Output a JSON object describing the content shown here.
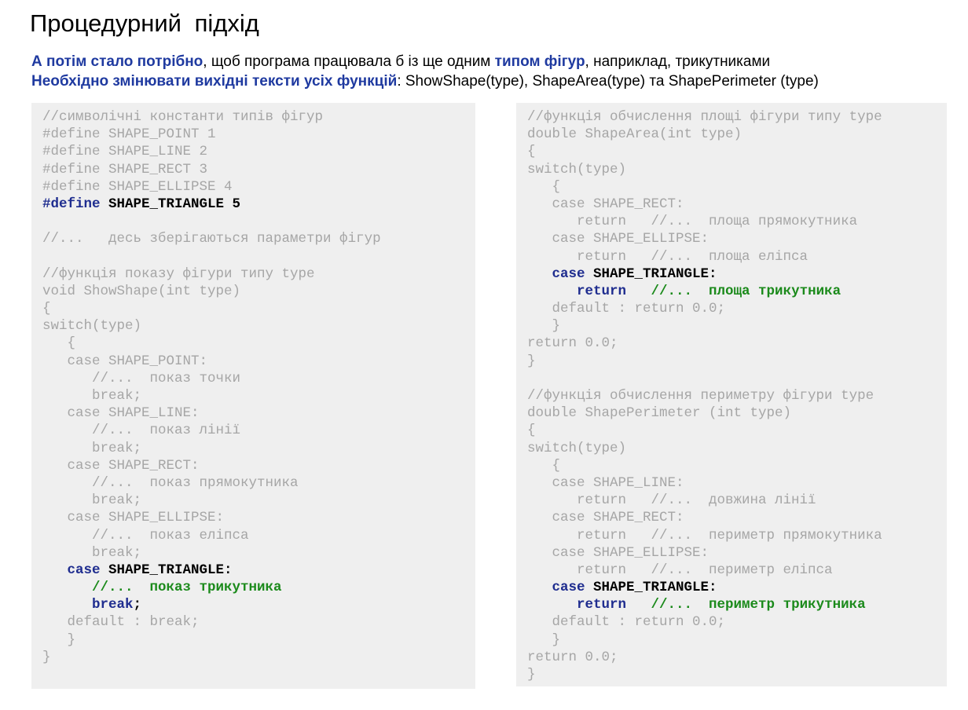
{
  "title": "Процедурний  підхід",
  "intro": {
    "line1": [
      {
        "t": "А потім стало потрібно",
        "hl": true
      },
      {
        "t": ", щоб програма працювала б із ще одним ",
        "hl": false
      },
      {
        "t": "типом фігур",
        "hl": true
      },
      {
        "t": ", наприклад, трикутниками",
        "hl": false
      }
    ],
    "line2": [
      {
        "t": "Необхідно змінювати вихідні тексти усіх функцій",
        "hl": true
      },
      {
        "t": ": ShowShape(type), ShapeArea(type) та ShapePerimeter  (type)",
        "hl": false
      }
    ]
  },
  "left_code": [
    {
      "segs": [
        {
          "t": "//символічні константи типів фігур"
        }
      ]
    },
    {
      "segs": [
        {
          "t": "#define SHAPE_POINT 1"
        }
      ]
    },
    {
      "segs": [
        {
          "t": "#define SHAPE_LINE 2"
        }
      ]
    },
    {
      "segs": [
        {
          "t": "#define SHAPE_RECT 3"
        }
      ]
    },
    {
      "segs": [
        {
          "t": "#define SHAPE_ELLIPSE 4"
        }
      ]
    },
    {
      "hl": true,
      "segs": [
        {
          "t": "#define ",
          "c": "kw"
        },
        {
          "t": "SHAPE_TRIANGLE 5",
          "c": "id"
        }
      ]
    },
    {
      "segs": [
        {
          "t": ""
        }
      ]
    },
    {
      "segs": [
        {
          "t": "//...   десь зберігаються параметри фігур"
        }
      ]
    },
    {
      "segs": [
        {
          "t": ""
        }
      ]
    },
    {
      "segs": [
        {
          "t": "//функція показу фігури типу type"
        }
      ]
    },
    {
      "segs": [
        {
          "t": "void ShowShape(int type)"
        }
      ]
    },
    {
      "segs": [
        {
          "t": "{"
        }
      ]
    },
    {
      "segs": [
        {
          "t": "switch(type)"
        }
      ]
    },
    {
      "segs": [
        {
          "t": "   {"
        }
      ]
    },
    {
      "segs": [
        {
          "t": "   case SHAPE_POINT:"
        }
      ]
    },
    {
      "segs": [
        {
          "t": "      //...  показ точки"
        }
      ]
    },
    {
      "segs": [
        {
          "t": "      break;"
        }
      ]
    },
    {
      "segs": [
        {
          "t": "   case SHAPE_LINE:"
        }
      ]
    },
    {
      "segs": [
        {
          "t": "      //...  показ лінії"
        }
      ]
    },
    {
      "segs": [
        {
          "t": "      break;"
        }
      ]
    },
    {
      "segs": [
        {
          "t": "   case SHAPE_RECT:"
        }
      ]
    },
    {
      "segs": [
        {
          "t": "      //...  показ прямокутника"
        }
      ]
    },
    {
      "segs": [
        {
          "t": "      break;"
        }
      ]
    },
    {
      "segs": [
        {
          "t": "   case SHAPE_ELLIPSE:"
        }
      ]
    },
    {
      "segs": [
        {
          "t": "      //...  показ еліпса"
        }
      ]
    },
    {
      "segs": [
        {
          "t": "      break;"
        }
      ]
    },
    {
      "hl": true,
      "segs": [
        {
          "t": "   case ",
          "c": "kw"
        },
        {
          "t": "SHAPE_TRIANGLE:",
          "c": "id"
        }
      ]
    },
    {
      "hl": true,
      "segs": [
        {
          "t": "      //...  показ трикутника",
          "c": "cm"
        }
      ]
    },
    {
      "hl": true,
      "segs": [
        {
          "t": "      break",
          "c": "kw"
        },
        {
          "t": ";",
          "c": "id"
        }
      ]
    },
    {
      "segs": [
        {
          "t": "   default : break;"
        }
      ]
    },
    {
      "segs": [
        {
          "t": "   }"
        }
      ]
    },
    {
      "segs": [
        {
          "t": "}"
        }
      ]
    }
  ],
  "right_code": [
    {
      "segs": [
        {
          "t": "//функція обчислення площі фігури типу type"
        }
      ]
    },
    {
      "segs": [
        {
          "t": "double ShapeArea(int type)"
        }
      ]
    },
    {
      "segs": [
        {
          "t": "{"
        }
      ]
    },
    {
      "segs": [
        {
          "t": "switch(type)"
        }
      ]
    },
    {
      "segs": [
        {
          "t": "   {"
        }
      ]
    },
    {
      "segs": [
        {
          "t": "   case SHAPE_RECT:"
        }
      ]
    },
    {
      "segs": [
        {
          "t": "      return   //...  площа прямокутника"
        }
      ]
    },
    {
      "segs": [
        {
          "t": "   case SHAPE_ELLIPSE:"
        }
      ]
    },
    {
      "segs": [
        {
          "t": "      return   //...  площа еліпса"
        }
      ]
    },
    {
      "hl": true,
      "segs": [
        {
          "t": "   case ",
          "c": "kw"
        },
        {
          "t": "SHAPE_TRIANGLE:",
          "c": "id"
        }
      ]
    },
    {
      "hl": true,
      "segs": [
        {
          "t": "      return",
          "c": "kw"
        },
        {
          "t": "   //...  площа трикутника",
          "c": "cm"
        }
      ]
    },
    {
      "segs": [
        {
          "t": "   default : return 0.0;"
        }
      ]
    },
    {
      "segs": [
        {
          "t": "   }"
        }
      ]
    },
    {
      "segs": [
        {
          "t": "return 0.0;"
        }
      ]
    },
    {
      "segs": [
        {
          "t": "}"
        }
      ]
    },
    {
      "segs": [
        {
          "t": ""
        }
      ]
    },
    {
      "segs": [
        {
          "t": "//функція обчислення периметру фігури type"
        }
      ]
    },
    {
      "segs": [
        {
          "t": "double ShapePerimeter (int type)"
        }
      ]
    },
    {
      "segs": [
        {
          "t": "{"
        }
      ]
    },
    {
      "segs": [
        {
          "t": "switch(type)"
        }
      ]
    },
    {
      "segs": [
        {
          "t": "   {"
        }
      ]
    },
    {
      "segs": [
        {
          "t": "   case SHAPE_LINE:"
        }
      ]
    },
    {
      "segs": [
        {
          "t": "      return   //...  довжина лінії"
        }
      ]
    },
    {
      "segs": [
        {
          "t": "   case SHAPE_RECT:"
        }
      ]
    },
    {
      "segs": [
        {
          "t": "      return   //...  периметр прямокутника"
        }
      ]
    },
    {
      "segs": [
        {
          "t": "   case SHAPE_ELLIPSE:"
        }
      ]
    },
    {
      "segs": [
        {
          "t": "      return   //...  периметр еліпса"
        }
      ]
    },
    {
      "hl": true,
      "segs": [
        {
          "t": "   case ",
          "c": "kw"
        },
        {
          "t": "SHAPE_TRIANGLE:",
          "c": "id"
        }
      ]
    },
    {
      "hl": true,
      "segs": [
        {
          "t": "      return",
          "c": "kw"
        },
        {
          "t": "   //...  периметр трикутника",
          "c": "cm"
        }
      ]
    },
    {
      "segs": [
        {
          "t": "   default : return 0.0;"
        }
      ]
    },
    {
      "segs": [
        {
          "t": "   }"
        }
      ]
    },
    {
      "segs": [
        {
          "t": "return 0.0;"
        }
      ]
    },
    {
      "segs": [
        {
          "t": "}"
        }
      ]
    }
  ],
  "colors": {
    "heading_highlight": "#1f3aa0",
    "code_default": "#a6a6a6",
    "code_keyword": "#1f2d8f",
    "code_identifier": "#000000",
    "code_comment": "#1b8a1b",
    "panel_bg": "#efefef"
  }
}
